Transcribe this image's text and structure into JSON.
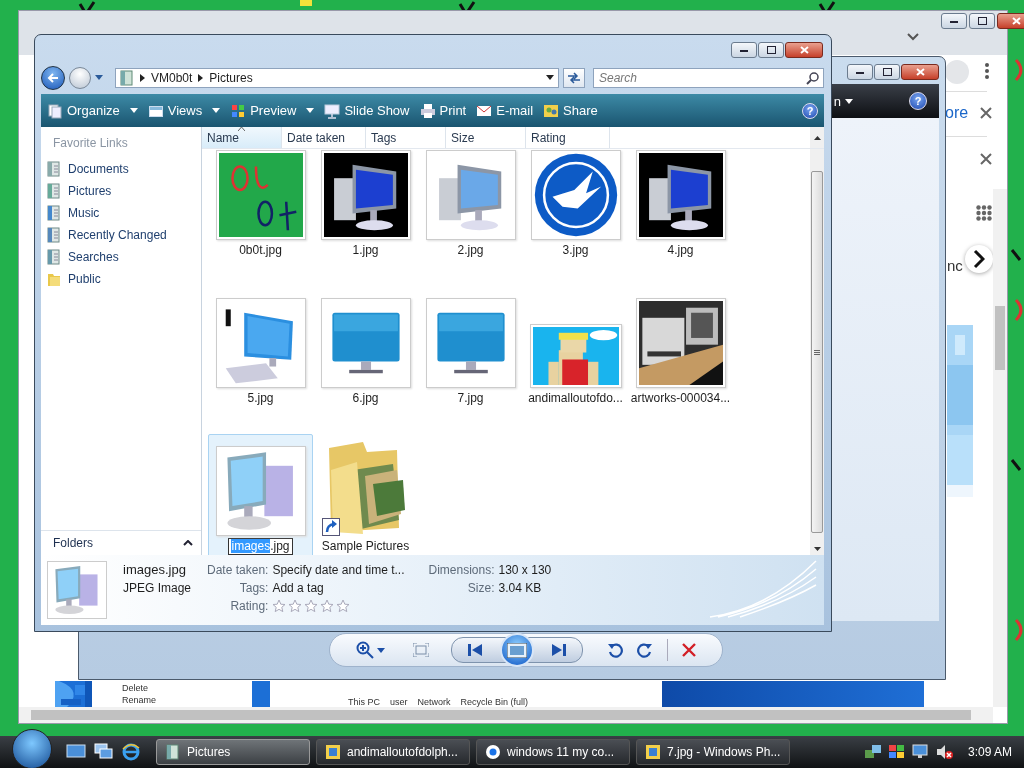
{
  "browser": {
    "partial_link": "ore",
    "partial_text": "nc",
    "page_image": {
      "menu_items": [
        "Delete",
        "Rename"
      ],
      "desktop_icons": [
        "This PC",
        "user",
        "Network",
        "Recycle Bin (full)"
      ]
    }
  },
  "viewer": {
    "partial_menu": "n",
    "help": "?"
  },
  "explorer": {
    "address": {
      "crumbs": [
        "VM0b0t",
        "Pictures"
      ]
    },
    "search": {
      "placeholder": "Search"
    },
    "toolbar": [
      {
        "label": "Organize",
        "dropdown": true
      },
      {
        "label": "Views",
        "dropdown": true
      },
      {
        "label": "Preview",
        "dropdown": true
      },
      {
        "label": "Slide Show",
        "dropdown": false
      },
      {
        "label": "Print",
        "dropdown": false
      },
      {
        "label": "E-mail",
        "dropdown": false
      },
      {
        "label": "Share",
        "dropdown": false
      }
    ],
    "help": "?",
    "favorites": {
      "title": "Favorite Links",
      "items": [
        "Documents",
        "Pictures",
        "Music",
        "Recently Changed",
        "Searches",
        "Public"
      ]
    },
    "folders": "Folders",
    "columns": [
      {
        "label": "Name",
        "sorted": true
      },
      {
        "label": "Date taken",
        "sorted": false
      },
      {
        "label": "Tags",
        "sorted": false
      },
      {
        "label": "Size",
        "sorted": false
      },
      {
        "label": "Rating",
        "sorted": false
      }
    ],
    "items": [
      {
        "name": "0b0t.jpg",
        "kind": "picture",
        "selected": false
      },
      {
        "name": "1.jpg",
        "kind": "picture",
        "selected": false
      },
      {
        "name": "2.jpg",
        "kind": "picture",
        "selected": false
      },
      {
        "name": "3.jpg",
        "kind": "picture",
        "selected": false
      },
      {
        "name": "4.jpg",
        "kind": "picture",
        "selected": false
      },
      {
        "name": "5.jpg",
        "kind": "picture",
        "selected": false
      },
      {
        "name": "6.jpg",
        "kind": "picture",
        "selected": false
      },
      {
        "name": "7.jpg",
        "kind": "picture",
        "selected": false
      },
      {
        "name": "andimalloutofdo...",
        "kind": "picture",
        "selected": false
      },
      {
        "name": "artworks-000034...",
        "kind": "picture",
        "selected": false
      },
      {
        "kind": "picture",
        "selected": true,
        "rename": {
          "selected_text": "images",
          "rest_text": ".jpg"
        }
      },
      {
        "name": "Sample Pictures",
        "kind": "folder",
        "selected": false
      }
    ],
    "details": {
      "name": "images.jpg",
      "type": "JPEG Image",
      "date_taken": {
        "label": "Date taken:",
        "value": "Specify date and time t..."
      },
      "tags": {
        "label": "Tags:",
        "value": "Add a tag"
      },
      "rating": {
        "label": "Rating:",
        "stars": 0
      },
      "dimensions": {
        "label": "Dimensions:",
        "value": "130 x 130"
      },
      "size": {
        "label": "Size:",
        "value": "3.04 KB"
      }
    }
  },
  "taskbar": {
    "tasks": [
      {
        "label": "Pictures",
        "selected": true
      },
      {
        "label": "andimalloutofdolph...",
        "selected": false
      },
      {
        "label": "windows 11 my co...",
        "selected": false
      },
      {
        "label": "7.jpg - Windows Ph...",
        "selected": false
      }
    ],
    "clock": "3:09 AM"
  }
}
